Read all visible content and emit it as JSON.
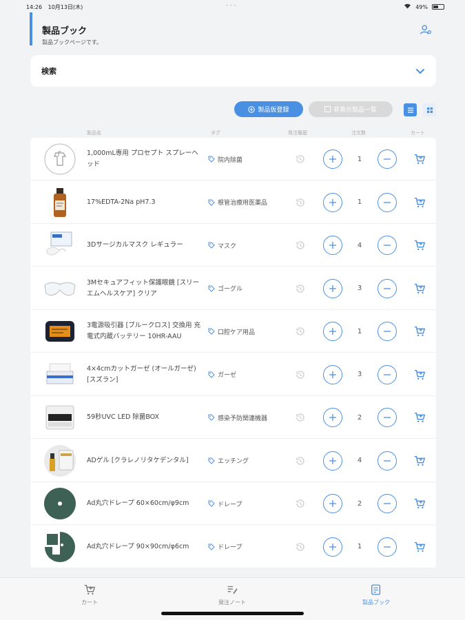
{
  "status_bar": {
    "time": "14:26",
    "date": "10月13日(木)",
    "battery": "49%"
  },
  "header": {
    "title": "製品ブック",
    "subtitle": "製品ブックページです。"
  },
  "search": {
    "label": "検索"
  },
  "actions": {
    "register_label": "製品仮登録",
    "hidden_label": "非表示製品一覧"
  },
  "columns": {
    "name": "製品名",
    "tag": "タグ",
    "history": "発注履歴",
    "quantity": "注文数",
    "cart": "カート"
  },
  "products": [
    {
      "name": "1,000mL専用 プロセプト スプレーヘッド",
      "tag": "院内除菌",
      "qty": "1",
      "thumb": "spray"
    },
    {
      "name": "17%EDTA-2Na pH7.3",
      "tag": "根管治療用医薬品",
      "qty": "1",
      "thumb": "bottle"
    },
    {
      "name": "3Dサージカルマスク レギュラー",
      "tag": "マスク",
      "qty": "4",
      "thumb": "mask"
    },
    {
      "name": "3Mセキュアフィット保護眼鏡 [スリーエムヘルスケア] クリア",
      "tag": "ゴーグル",
      "qty": "3",
      "thumb": "glasses"
    },
    {
      "name": "3電源吸引器 [ブルークロス] 交換用 充電式内蔵バッテリー 10HR-AAU",
      "tag": "口腔ケア用品",
      "qty": "1",
      "thumb": "battery"
    },
    {
      "name": "4×4cmカットガーゼ (オールガーゼ) [スズラン]",
      "tag": "ガーゼ",
      "qty": "3",
      "thumb": "gauze"
    },
    {
      "name": "59秒UVC LED 除菌BOX",
      "tag": "感染予防関連機器",
      "qty": "2",
      "thumb": "uvbox"
    },
    {
      "name": "ADゲル [クラレノリタケデンタル]",
      "tag": "エッチング",
      "qty": "4",
      "thumb": "gel"
    },
    {
      "name": "Ad丸穴ドレープ 60×60cm/φ9cm",
      "tag": "ドレープ",
      "qty": "2",
      "thumb": "drape-round"
    },
    {
      "name": "Ad丸穴ドレープ 90×90cm/φ6cm",
      "tag": "ドレープ",
      "qty": "1",
      "thumb": "drape-square"
    }
  ],
  "tabbar": {
    "cart": "カート",
    "order_note": "発注ノート",
    "product_book": "製品ブック"
  },
  "colors": {
    "accent": "#4a90e2",
    "background": "#f2f3f5"
  }
}
